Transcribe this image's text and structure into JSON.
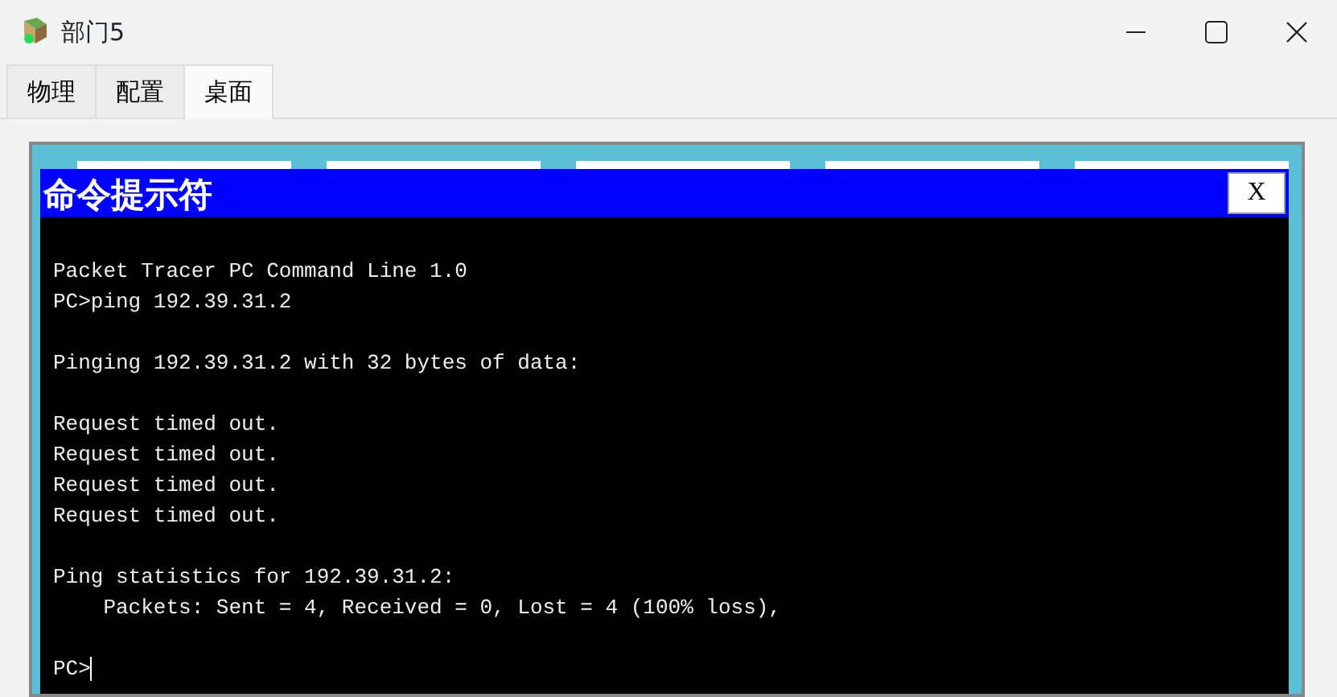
{
  "window": {
    "title": "部门5"
  },
  "tabs": [
    {
      "label": "物理",
      "selected": false
    },
    {
      "label": "配置",
      "selected": false
    },
    {
      "label": "桌面",
      "selected": true
    }
  ],
  "terminal": {
    "title": "命令提示符",
    "close": "X",
    "blocks": [
      [
        "Packet Tracer PC Command Line 1.0",
        "PC>ping 192.39.31.2"
      ],
      [
        "Pinging 192.39.31.2 with 32 bytes of data:"
      ],
      [
        "Request timed out.",
        "Request timed out.",
        "Request timed out.",
        "Request timed out."
      ],
      [
        "Ping statistics for 192.39.31.2:",
        "    Packets: Sent = 4, Received = 0, Lost = 4 (100% loss),"
      ],
      [
        "PC>"
      ]
    ],
    "cursor": true
  }
}
